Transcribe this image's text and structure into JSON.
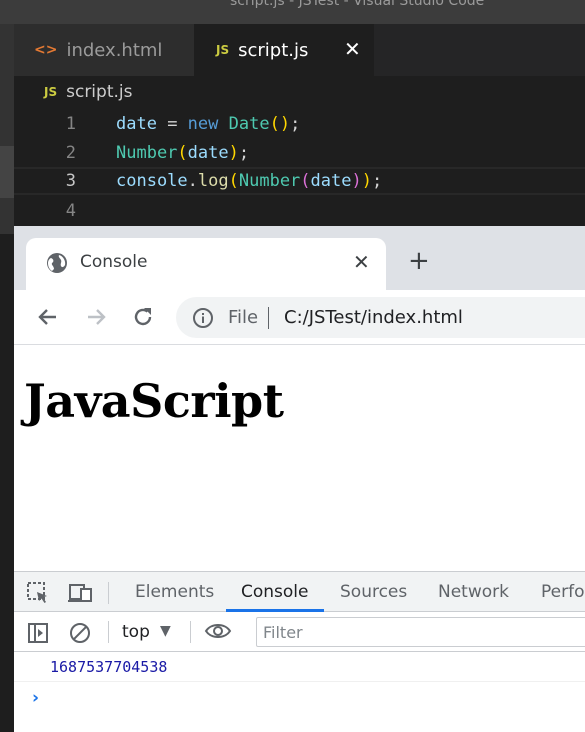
{
  "vscode": {
    "window_title": "script.js - JSTest - Visual Studio Code",
    "tabs": [
      {
        "label": "index.html",
        "icon": "html-file-icon",
        "active": false
      },
      {
        "label": "script.js",
        "icon": "js-file-icon",
        "active": true
      }
    ],
    "js_badge": "JS",
    "html_badge": "<>",
    "close_glyph": "✕",
    "breadcrumb": "script.js",
    "lines": [
      {
        "n": "1"
      },
      {
        "n": "2"
      },
      {
        "n": "3"
      },
      {
        "n": "4"
      }
    ]
  },
  "browser": {
    "tab_title": "Console",
    "tab_close": "✕",
    "new_tab": "+",
    "omnibox": {
      "scheme_label": "File",
      "url": "C:/JSTest/index.html"
    },
    "page_heading": "JavaScript"
  },
  "devtools": {
    "tabs": [
      "Elements",
      "Console",
      "Sources",
      "Network",
      "Perfor"
    ],
    "active_tab": "Console",
    "context": "top",
    "context_arrow": "▼",
    "filter_placeholder": "Filter",
    "log_output": "1687537704538",
    "prompt": "›"
  },
  "colors": {
    "vscode_bg": "#1e1e1e",
    "keyword": "#569cd6",
    "devtools_accent": "#1a73e8",
    "log_number": "#1a1aa6"
  }
}
